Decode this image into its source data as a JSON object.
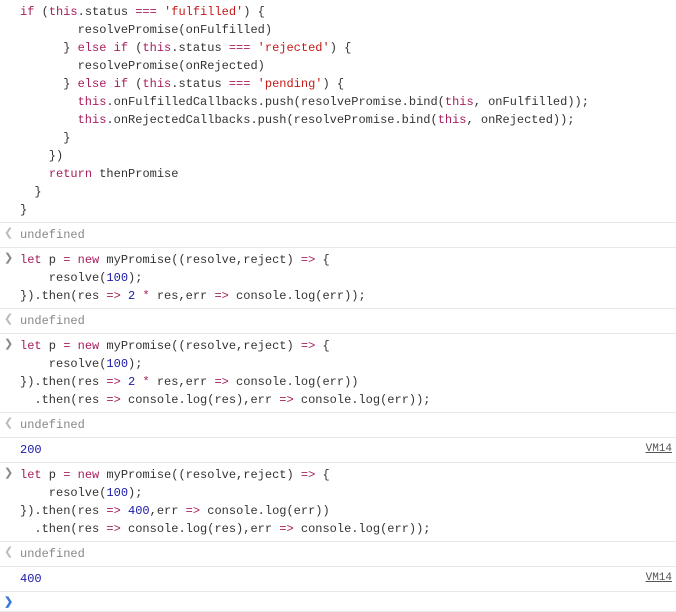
{
  "entries": [
    {
      "type": "code-block",
      "raw": "      if (this.status === 'fulfilled') {\n        resolvePromise(onFulfilled)\n      } else if (this.status === 'rejected') {\n        resolvePromise(onRejected)\n      } else if (this.status === 'pending') {\n        this.onFulfilledCallbacks.push(resolvePromise.bind(this, onFulfilled));\n        this.onRejectedCallbacks.push(resolvePromise.bind(this, onRejected));\n      }\n    })\n    return thenPromise\n  }\n}"
    },
    {
      "type": "result",
      "value": "undefined"
    },
    {
      "type": "input",
      "raw": "let p = new myPromise((resolve,reject) => {\n    resolve(100);\n}).then(res => 2 * res,err => console.log(err));"
    },
    {
      "type": "result",
      "value": "undefined"
    },
    {
      "type": "input",
      "raw": "let p = new myPromise((resolve,reject) => {\n    resolve(100);\n}).then(res => 2 * res,err => console.log(err))\n  .then(res => console.log(res),err => console.log(err));"
    },
    {
      "type": "result",
      "value": "undefined"
    },
    {
      "type": "log",
      "value": "200",
      "source": "VM14"
    },
    {
      "type": "input",
      "raw": "let p = new myPromise((resolve,reject) => {\n    resolve(100);\n}).then(res => 400,err => console.log(err))\n  .then(res => console.log(res),err => console.log(err));"
    },
    {
      "type": "result",
      "value": "undefined"
    },
    {
      "type": "log",
      "value": "400",
      "source": "VM14"
    },
    {
      "type": "prompt"
    }
  ]
}
